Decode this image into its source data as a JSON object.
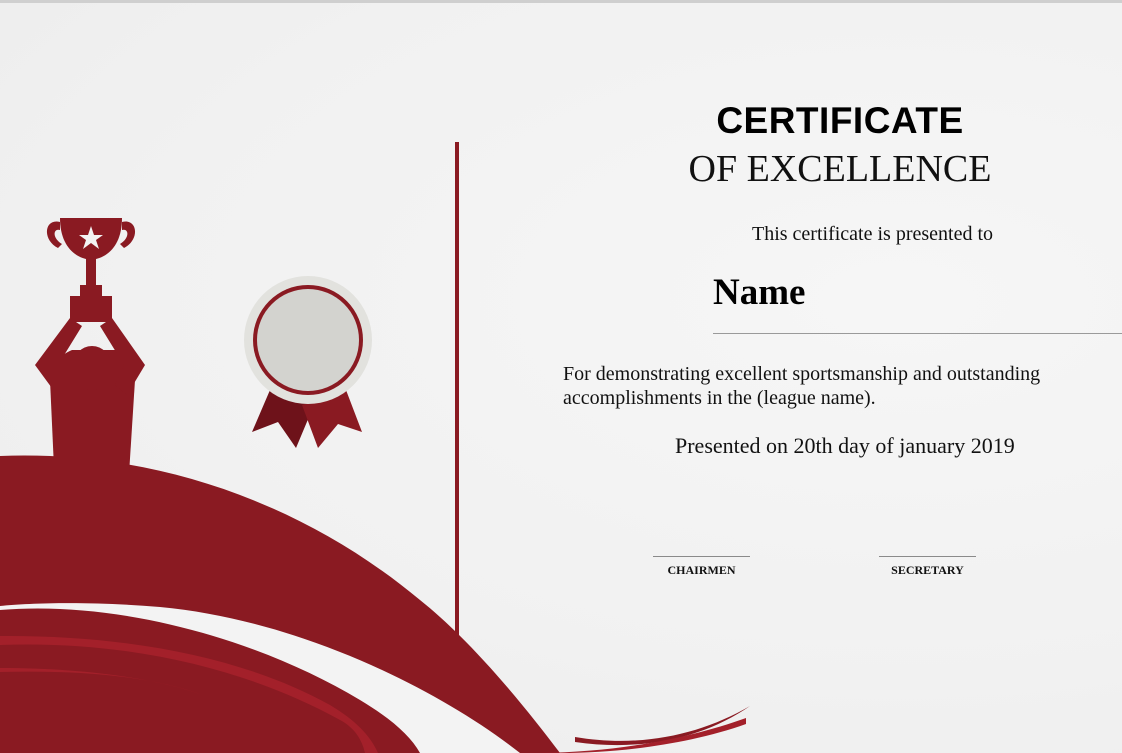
{
  "certificate": {
    "title": "CERTIFICATE",
    "subtitle": "OF EXCELLENCE",
    "presented_to": "This certificate is presented to",
    "recipient_name": "Name",
    "reason": "For demonstrating excellent sportsmanship and outstanding accomplishments in the (league name).",
    "date_line": "Presented on 20th day of january 2019"
  },
  "signatures": {
    "left_label": "CHAIRMEN",
    "right_label": "SECRETARY"
  },
  "colors": {
    "accent": "#8a1a22",
    "accent_dark": "#6e121a",
    "medal_face": "#d3d3cf",
    "medal_ring": "#e2e2de"
  },
  "icons": {
    "trophy": "trophy-icon",
    "person": "athlete-silhouette",
    "medal": "award-medal-icon"
  }
}
